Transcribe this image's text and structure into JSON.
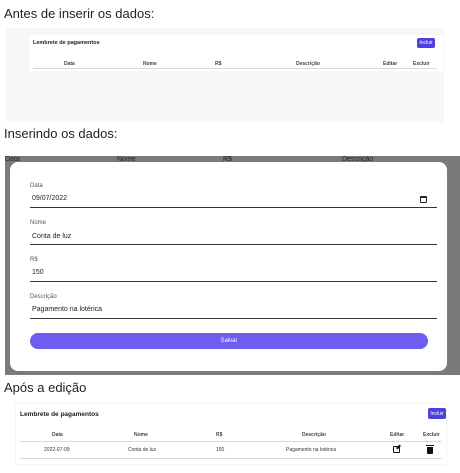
{
  "section_before": {
    "caption": "Antes de inserir os dados:",
    "card_title": "Lembrete de pagamentos",
    "incluir_label": "Incluir",
    "headers": [
      "Data",
      "Nome",
      "R$",
      "Descrição",
      "Editar",
      "Excluir"
    ]
  },
  "section_inserting": {
    "caption": "Inserindo os dados:",
    "behind_headers": [
      "Data",
      "Nome",
      "R$",
      "Descrição"
    ],
    "fields": {
      "data": {
        "label": "Data",
        "value": "09/07/2022"
      },
      "nome": {
        "label": "Nome",
        "value": "Conta de luz"
      },
      "rs": {
        "label": "R$",
        "value": "150"
      },
      "descricao": {
        "label": "Descrição",
        "value": "Pagamento na lotérica"
      }
    },
    "salvar_label": "Salvar"
  },
  "section_after": {
    "caption": "Após a edição",
    "card_title": "Lembrete de pagamentos",
    "incluir_label": "Incluir",
    "headers": [
      "Data",
      "Nome",
      "R$",
      "Descrição",
      "Editar",
      "Excluir"
    ],
    "rows": [
      {
        "data": "2022-07-09",
        "nome": "Conta de luz",
        "rs": "150",
        "descricao": "Pagamento na lotérica"
      }
    ]
  },
  "icons": {
    "edit": "edit-icon",
    "delete": "trash-icon",
    "calendar": "calendar-icon"
  },
  "colors": {
    "accent": "#4b3fe0",
    "save_button": "#6d5df0",
    "overlay": "#7a7a7a"
  }
}
